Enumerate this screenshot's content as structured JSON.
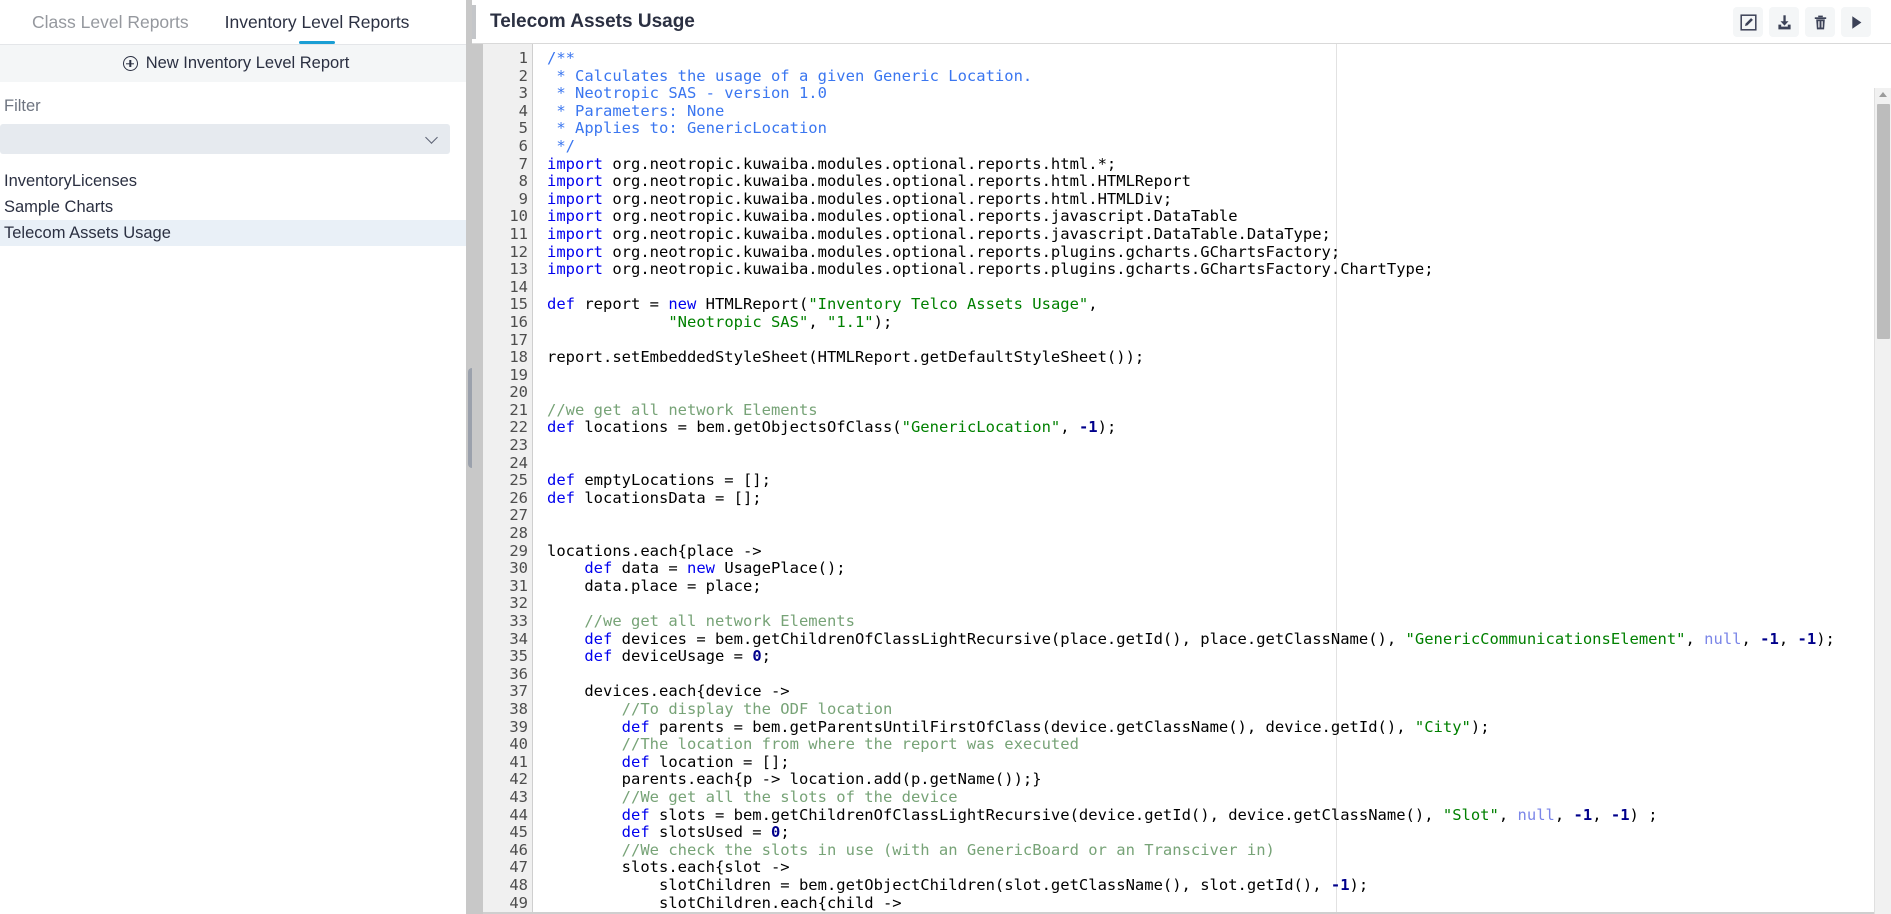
{
  "tabs": [
    {
      "label": "Class Level Reports",
      "active": false
    },
    {
      "label": "Inventory Level Reports",
      "active": true
    }
  ],
  "sidebar": {
    "new_report_button": "New Inventory Level Report",
    "new_report_icon": "plus-circle-icon",
    "filter_label": "Filter",
    "filter_value": "",
    "filter_placeholder": "",
    "filter_chevron_icon": "chevron-down-icon",
    "items": [
      {
        "label": "InventoryLicenses",
        "selected": false
      },
      {
        "label": "Sample Charts",
        "selected": false
      },
      {
        "label": "Telecom Assets Usage",
        "selected": true
      }
    ]
  },
  "report": {
    "title": "Telecom Assets Usage",
    "actions": [
      {
        "name": "edit-report-button",
        "icon": "pencil-square-icon",
        "label": "Edit"
      },
      {
        "name": "download-report-button",
        "icon": "download-icon",
        "label": "Download"
      },
      {
        "name": "delete-report-button",
        "icon": "trash-icon",
        "label": "Delete"
      },
      {
        "name": "run-report-button",
        "icon": "play-icon",
        "label": "Run"
      }
    ]
  },
  "editor": {
    "language": "groovy",
    "first_visible_line": 1,
    "last_visible_line": 49,
    "fold_lines": [
      1,
      15,
      29,
      37,
      47,
      49
    ],
    "line_numbers": [
      1,
      2,
      3,
      4,
      5,
      6,
      7,
      8,
      9,
      10,
      11,
      12,
      13,
      14,
      15,
      16,
      17,
      18,
      19,
      20,
      21,
      22,
      23,
      24,
      25,
      26,
      27,
      28,
      29,
      30,
      31,
      32,
      33,
      34,
      35,
      36,
      37,
      38,
      39,
      40,
      41,
      42,
      43,
      44,
      45,
      46,
      47,
      48,
      49
    ],
    "lines": [
      "/**",
      " * Calculates the usage of a given Generic Location.",
      " * Neotropic SAS - version 1.0",
      " * Parameters: None",
      " * Applies to: GenericLocation",
      " */",
      "import org.neotropic.kuwaiba.modules.optional.reports.html.*;",
      "import org.neotropic.kuwaiba.modules.optional.reports.html.HTMLReport",
      "import org.neotropic.kuwaiba.modules.optional.reports.html.HTMLDiv;",
      "import org.neotropic.kuwaiba.modules.optional.reports.javascript.DataTable",
      "import org.neotropic.kuwaiba.modules.optional.reports.javascript.DataTable.DataType;",
      "import org.neotropic.kuwaiba.modules.optional.reports.plugins.gcharts.GChartsFactory;",
      "import org.neotropic.kuwaiba.modules.optional.reports.plugins.gcharts.GChartsFactory.ChartType;",
      "",
      "def report = new HTMLReport(\"Inventory Telco Assets Usage\",",
      "             \"Neotropic SAS\", \"1.1\");",
      "",
      "report.setEmbeddedStyleSheet(HTMLReport.getDefaultStyleSheet());",
      "",
      "",
      "//we get all network Elements",
      "def locations = bem.getObjectsOfClass(\"GenericLocation\", -1);",
      "",
      "",
      "def emptyLocations = [];",
      "def locationsData = [];",
      "",
      "",
      "locations.each{place ->",
      "    def data = new UsagePlace();",
      "    data.place = place;",
      "",
      "    //we get all network Elements",
      "    def devices = bem.getChildrenOfClassLightRecursive(place.getId(), place.getClassName(), \"GenericCommunicationsElement\", null, -1, -1);",
      "    def deviceUsage = 0;",
      "",
      "    devices.each{device ->",
      "        //To display the ODF location",
      "        def parents = bem.getParentsUntilFirstOfClass(device.getClassName(), device.getId(), \"City\");",
      "        //The location from where the report was executed",
      "        def location = [];",
      "        parents.each{p -> location.add(p.getName());}",
      "        //We get all the slots of the device",
      "        def slots = bem.getChildrenOfClassLightRecursive(device.getId(), device.getClassName(), \"Slot\", null, -1, -1) ;",
      "        def slotsUsed = 0;",
      "        //We check the slots in use (with an GenericBoard or an Transciver in)",
      "        slots.each{slot ->",
      "            slotChildren = bem.getObjectChildren(slot.getClassName(), slot.getId(), -1);",
      "            slotChildren.each{child ->"
    ]
  },
  "colors": {
    "accent_tab": "#1a9ed4",
    "text_primary": "#2b3042",
    "text_muted": "#95989e",
    "selected_row": "#e9f0f7",
    "filter_bg": "#e6eaef",
    "gutter_bg": "#f0f0f0",
    "block_comment": "#3a76f0",
    "line_comment": "#77a377",
    "keyword": "#0000ee",
    "string": "#008000",
    "number": "#00008b",
    "null_literal": "#7b86e8"
  }
}
